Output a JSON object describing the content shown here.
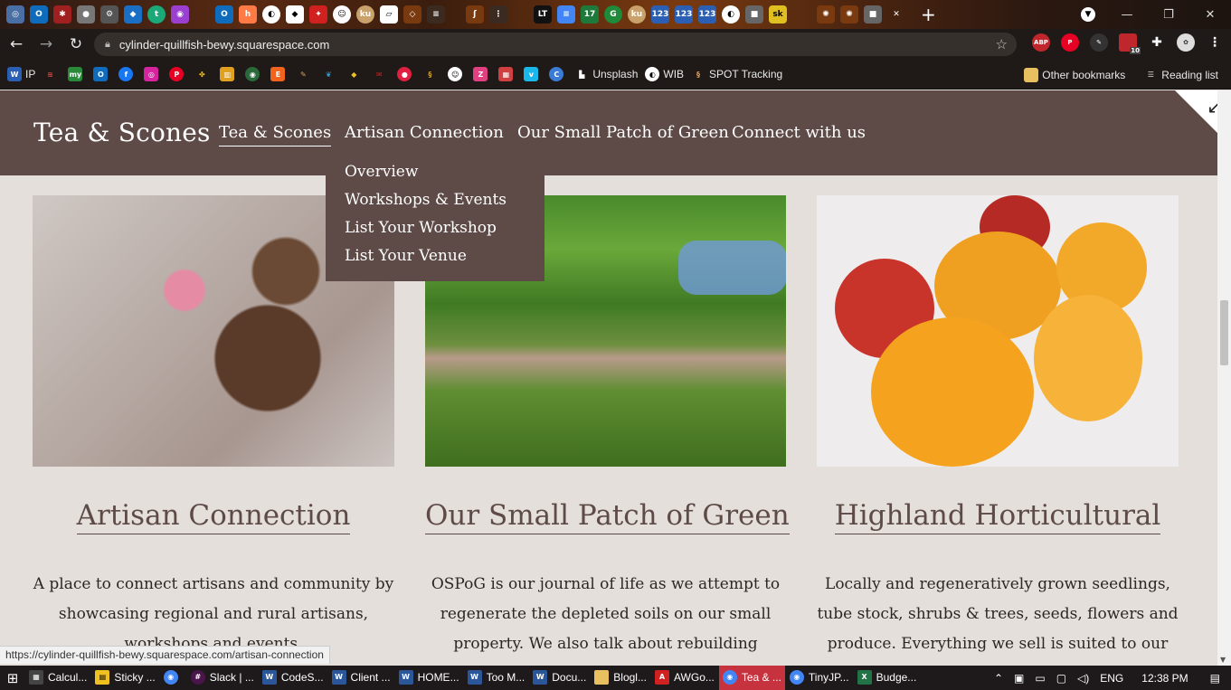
{
  "browser": {
    "url": "cylinder-quillfish-bewy.squarespace.com",
    "status_url": "https://cylinder-quillfish-bewy.squarespace.com/artisan-connection",
    "calendar_badge": "10",
    "bookmarks": {
      "ip": "IP",
      "unsplash": "Unsplash",
      "wib": "WIB",
      "spot": "SPOT Tracking",
      "other": "Other bookmarks",
      "reading": "Reading list"
    }
  },
  "site": {
    "title": "Tea & Scones",
    "nav": {
      "tea": "Tea & Scones",
      "artisan": "Artisan Connection",
      "green": "Our Small Patch of Green",
      "connect": "Connect with us"
    },
    "dropdown": [
      "Overview",
      "Workshops & Events",
      "List Your Workshop",
      "List Your Venue"
    ]
  },
  "cards": {
    "artisan": {
      "title": "Artisan Connection",
      "desc": "A place to connect artisans and community by showcasing regional and rural artisans, workshops and events."
    },
    "green": {
      "title": "Our Small Patch of Green",
      "desc": "OSPoG is our journal of life as we attempt to regenerate the depleted soils on our small property. We also talk about rebuilding"
    },
    "highland": {
      "title": "Highland Horticultural",
      "desc": "Locally and regeneratively grown seedlings, tube stock, shrubs & trees, seeds, flowers and produce. Everything we sell is suited to our cool"
    }
  },
  "taskbar": {
    "items": [
      "Calcul...",
      "Sticky ...",
      "Slack | ...",
      "CodeS...",
      "Client ...",
      "HOME...",
      "Too M...",
      "Docu...",
      "Blogl...",
      "AWGo...",
      "Tea & ...",
      "TinyJP...",
      "Budge..."
    ],
    "lang": "ENG",
    "time": "12:38 PM"
  }
}
